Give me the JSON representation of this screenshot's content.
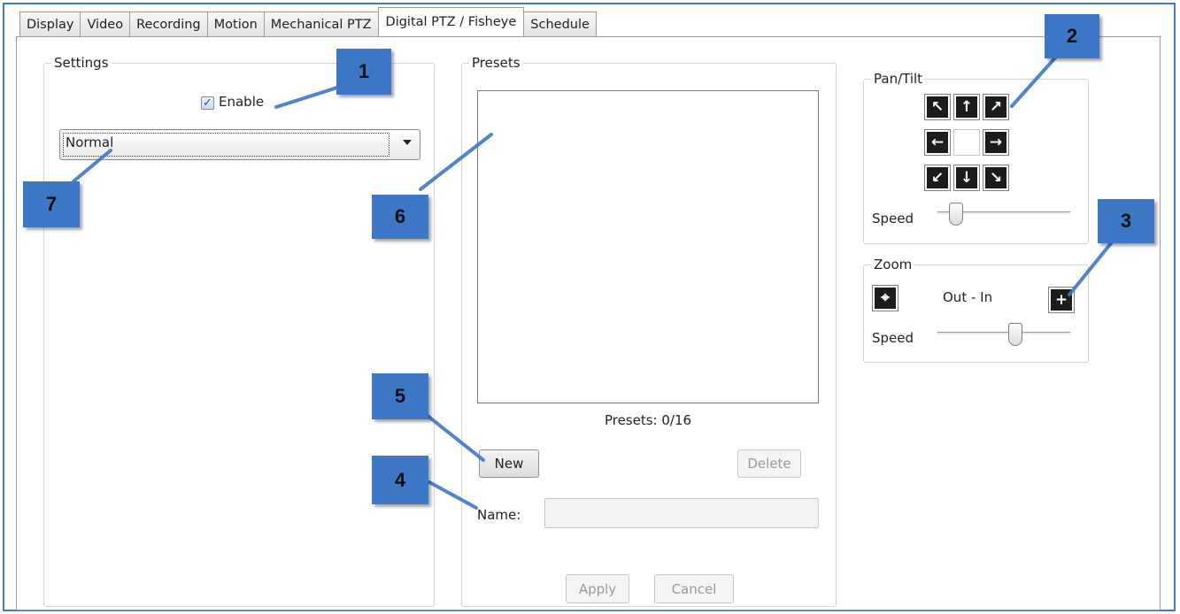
{
  "tabs": [
    {
      "label": "Display",
      "active": false
    },
    {
      "label": "Video",
      "active": false
    },
    {
      "label": "Recording",
      "active": false
    },
    {
      "label": "Motion",
      "active": false
    },
    {
      "label": "Mechanical PTZ",
      "active": false
    },
    {
      "label": "Digital PTZ / Fisheye",
      "active": true
    },
    {
      "label": "Schedule",
      "active": false
    }
  ],
  "settings": {
    "legend": "Settings",
    "enable_label": "Enable",
    "enable_checked": true,
    "mode_selected": "Normal"
  },
  "presets": {
    "legend": "Presets",
    "count_text": "Presets:  0/16",
    "new_label": "New",
    "delete_label": "Delete",
    "name_label": "Name:",
    "name_value": "",
    "apply_label": "Apply",
    "cancel_label": "Cancel"
  },
  "pantilt": {
    "legend": "Pan/Tilt",
    "speed_label": "Speed",
    "speed_level": 0.1
  },
  "zoom": {
    "legend": "Zoom",
    "range_label": "Out - In",
    "speed_label": "Speed",
    "speed_level": 0.6
  },
  "icons": {
    "up_left": "↖",
    "up": "↑",
    "up_right": "↗",
    "left": "←",
    "right": "→",
    "down_left": "↙",
    "down": "↓",
    "down_right": "↘",
    "zoom_out": "⌖",
    "zoom_in": "+",
    "check": "✓"
  },
  "callouts": [
    "1",
    "2",
    "3",
    "4",
    "5",
    "6",
    "7"
  ],
  "colors": {
    "frame": "#3d7ec4",
    "callout": "#3f77c7"
  }
}
